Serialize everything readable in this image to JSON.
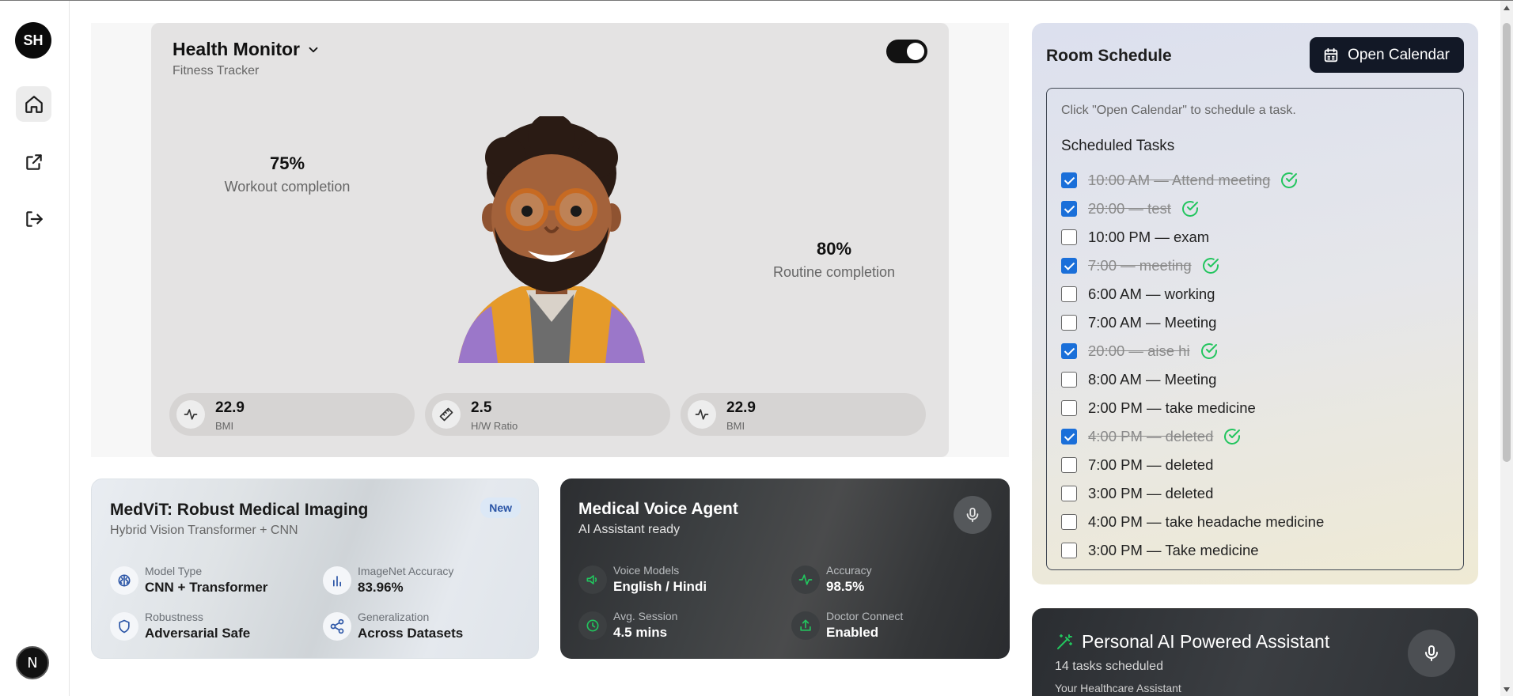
{
  "rail": {
    "user_initials": "SH",
    "items": [
      {
        "name": "home",
        "icon": "home-icon"
      },
      {
        "name": "external",
        "icon": "external-link-icon"
      },
      {
        "name": "logout",
        "icon": "logout-icon"
      }
    ],
    "bottom_badge": "N"
  },
  "health": {
    "title": "Health Monitor",
    "subtitle": "Fitness Tracker",
    "toggle_on": true,
    "workout": {
      "value": "75%",
      "label": "Workout completion"
    },
    "routine": {
      "value": "80%",
      "label": "Routine completion"
    },
    "pills": [
      {
        "value": "22.9",
        "label": "BMI",
        "icon": "activity-icon"
      },
      {
        "value": "2.5",
        "label": "H/W Ratio",
        "icon": "ruler-icon"
      },
      {
        "value": "22.9",
        "label": "BMI",
        "icon": "activity-icon"
      }
    ]
  },
  "medvit": {
    "title": "MedViT: Robust Medical Imaging",
    "subtitle": "Hybrid Vision Transformer + CNN",
    "badge": "New",
    "features": [
      {
        "label": "Model Type",
        "value": "CNN + Transformer",
        "icon": "brain-icon"
      },
      {
        "label": "ImageNet Accuracy",
        "value": "83.96%",
        "icon": "bar-chart-icon"
      },
      {
        "label": "Robustness",
        "value": "Adversarial Safe",
        "icon": "shield-icon"
      },
      {
        "label": "Generalization",
        "value": "Across Datasets",
        "icon": "share-icon"
      }
    ]
  },
  "voice": {
    "title": "Medical Voice Agent",
    "subtitle": "AI Assistant ready",
    "features": [
      {
        "label": "Voice Models",
        "value": "English / Hindi",
        "icon": "speaker-icon"
      },
      {
        "label": "Accuracy",
        "value": "98.5%",
        "icon": "activity-icon"
      },
      {
        "label": "Avg. Session",
        "value": "4.5 mins",
        "icon": "clock-icon"
      },
      {
        "label": "Doctor Connect",
        "value": "Enabled",
        "icon": "upload-icon"
      }
    ]
  },
  "room": {
    "title": "Room Schedule",
    "open_calendar_label": "Open Calendar",
    "hint": "Click \"Open Calendar\" to schedule a task.",
    "tasks_heading": "Scheduled Tasks",
    "tasks": [
      {
        "text": "10:00 AM — Attend meeting",
        "done": true
      },
      {
        "text": "20:00 — test",
        "done": true
      },
      {
        "text": "10:00 PM — exam",
        "done": false
      },
      {
        "text": "7:00 — meeting",
        "done": true
      },
      {
        "text": "6:00 AM — working",
        "done": false
      },
      {
        "text": "7:00 AM — Meeting",
        "done": false
      },
      {
        "text": "20:00 — aise hi",
        "done": true
      },
      {
        "text": "8:00 AM — Meeting",
        "done": false
      },
      {
        "text": "2:00 PM — take medicine",
        "done": false
      },
      {
        "text": "4:00 PM — deleted",
        "done": true
      },
      {
        "text": "7:00 PM — deleted",
        "done": false
      },
      {
        "text": "3:00 PM — deleted",
        "done": false
      },
      {
        "text": "4:00 PM — take headache medicine",
        "done": false
      },
      {
        "text": "3:00 PM — Take medicine",
        "done": false
      }
    ]
  },
  "assistant": {
    "title": "Personal AI Powered Assistant",
    "count_text": "14 tasks scheduled",
    "subtitle": "Your Healthcare Assistant"
  },
  "colors": {
    "accent_dark": "#121826",
    "checkbox_blue": "#1a6fd9",
    "done_green": "#22c55e"
  }
}
